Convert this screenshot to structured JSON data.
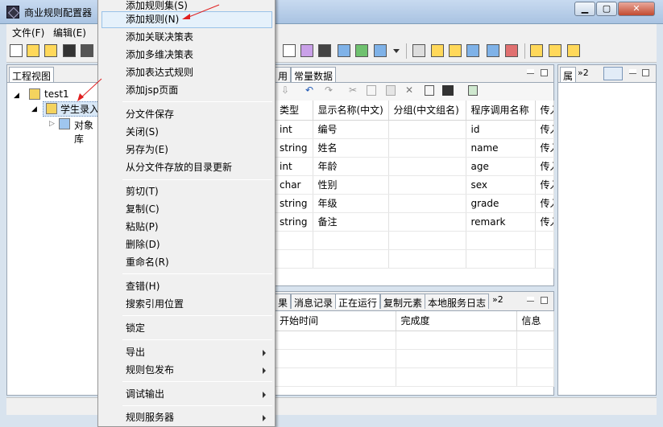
{
  "window": {
    "title": "商业规则配置器",
    "min_label": "▁",
    "max_label": "▢",
    "close_label": "✕"
  },
  "menubar": {
    "items": [
      "文件(F)",
      "编辑(E)"
    ]
  },
  "project_view": {
    "tab": "工程视图",
    "tree": [
      "test1",
      "学生录入",
      "对象库"
    ]
  },
  "editor": {
    "tabs_visible": [
      "用",
      "常量数据"
    ],
    "columns": [
      "类型",
      "显示名称(中文)",
      "分组(中文组名)",
      "程序调用名称",
      "传入"
    ],
    "rows": [
      [
        "int",
        "编号",
        "",
        "id",
        "传入"
      ],
      [
        "string",
        "姓名",
        "",
        "name",
        "传入"
      ],
      [
        "int",
        "年龄",
        "",
        "age",
        "传入"
      ],
      [
        "char",
        "性别",
        "",
        "sex",
        "传入"
      ],
      [
        "string",
        "年级",
        "",
        "grade",
        "传入"
      ],
      [
        "string",
        "备注",
        "",
        "remark",
        "传入"
      ]
    ]
  },
  "bottom_panel": {
    "tabs": [
      "果",
      "消息记录",
      "正在运行",
      "复制元素",
      "本地服务日志",
      "»2"
    ],
    "active_tab": "正在运行",
    "columns": [
      "开始时间",
      "完成度",
      "信息"
    ]
  },
  "right_panel": {
    "tab": "属",
    "overflow": "»2"
  },
  "context_menu": {
    "items": [
      {
        "label": "添加规则集(S)"
      },
      {
        "label": "添加规则(N)",
        "highlight": true
      },
      {
        "label": "添加关联决策表"
      },
      {
        "label": "添加多维决策表"
      },
      {
        "label": "添加表达式规则"
      },
      {
        "label": "添加jsp页面"
      },
      {
        "label": "分文件保存"
      },
      {
        "label": "关闭(S)"
      },
      {
        "label": "另存为(E)"
      },
      {
        "label": "从分文件存放的目录更新"
      },
      {
        "label": "剪切(T)"
      },
      {
        "label": "复制(C)"
      },
      {
        "label": "粘贴(P)"
      },
      {
        "label": "删除(D)"
      },
      {
        "label": "重命名(R)"
      },
      {
        "label": "查错(H)"
      },
      {
        "label": "搜索引用位置"
      },
      {
        "label": "锁定"
      },
      {
        "label": "导出",
        "submenu": true
      },
      {
        "label": "规则包发布",
        "submenu": true
      },
      {
        "label": "调试输出",
        "submenu": true
      },
      {
        "label": "规则服务器",
        "submenu": true
      }
    ]
  },
  "colors": {
    "highlight": "#e5f1fb",
    "annotation_arrow": "#e02020"
  }
}
